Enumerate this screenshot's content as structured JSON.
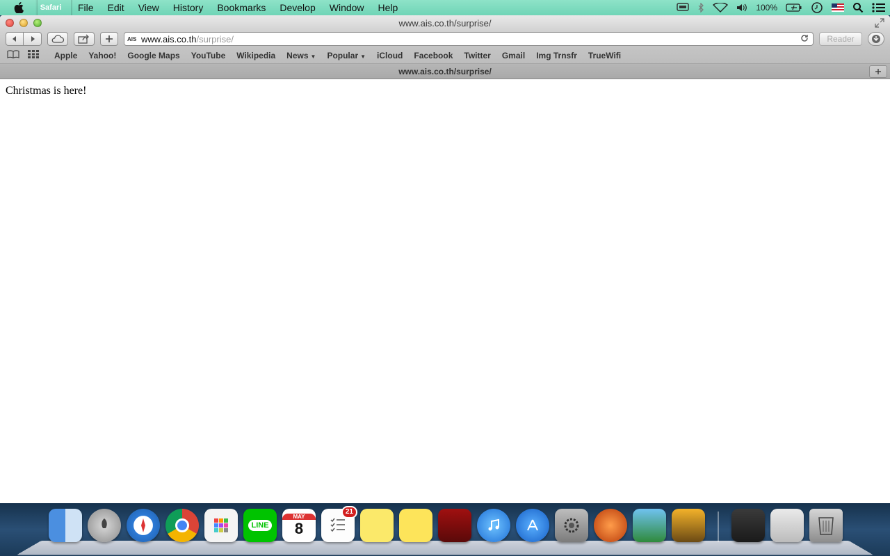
{
  "menubar": {
    "app_name": "Safari",
    "items": [
      "File",
      "Edit",
      "View",
      "History",
      "Bookmarks",
      "Develop",
      "Window",
      "Help"
    ],
    "battery": "100%",
    "icons": [
      "display-icon",
      "bluetooth-icon",
      "wifi-icon",
      "volume-icon",
      "battery-icon",
      "time-machine-icon",
      "flag-icon",
      "spotlight-icon",
      "notification-center-icon"
    ]
  },
  "window": {
    "title": "www.ais.co.th/surprise/"
  },
  "toolbar": {
    "url_host": "www.ais.co.th",
    "url_path": "/surprise/",
    "favicon_text": "AIS",
    "reader_label": "Reader"
  },
  "bookmarks": [
    "Apple",
    "Yahoo!",
    "Google Maps",
    "YouTube",
    "Wikipedia",
    "News",
    "Popular",
    "iCloud",
    "Facebook",
    "Twitter",
    "Gmail",
    "Img Trnsfr",
    "TrueWifi"
  ],
  "tab": {
    "title": "www.ais.co.th/surprise/"
  },
  "page": {
    "text": "Christmas is here!"
  },
  "dock": {
    "calendar_month": "MAY",
    "calendar_day": "8",
    "reminders_badge": "21",
    "line_label": "LINE"
  },
  "colors": {
    "menubar": "#7edbbe",
    "accent_red": "#d21f1f"
  }
}
